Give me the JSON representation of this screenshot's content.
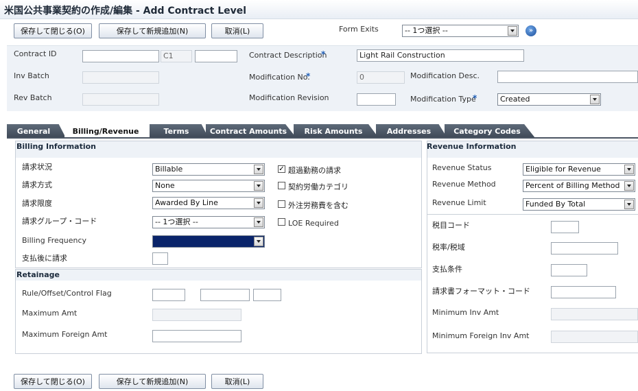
{
  "window": {
    "title": "米国公共事業契約の作成/編集 - Add Contract Level"
  },
  "toolbar": {
    "save_close": "保存して閉じる(O)",
    "save_new": "保存して新規追加(N)",
    "cancel": "取消(L)",
    "form_exits_label": "Form Exits",
    "form_exits_value": "-- 1つ選択 --"
  },
  "header": {
    "contract_id_label": "Contract ID",
    "contract_id_value": "",
    "contract_type": "C1",
    "contract_company": "",
    "contract_desc_label": "Contract Description",
    "contract_desc_value": "Light Rail Construction",
    "inv_batch_label": "Inv Batch",
    "rev_batch_label": "Rev Batch",
    "mod_no_label": "Modification No.",
    "mod_no_value": "0",
    "mod_desc_label": "Modification Desc.",
    "mod_desc_value": "",
    "mod_rev_label": "Modification Revision",
    "mod_rev_value": "",
    "mod_type_label": "Modification Type",
    "mod_type_value": "Created",
    "required_mark": "*"
  },
  "tabs": [
    {
      "label": "General"
    },
    {
      "label": "Billing/Revenue"
    },
    {
      "label": "Terms"
    },
    {
      "label": "Contract Amounts"
    },
    {
      "label": "Risk Amounts"
    },
    {
      "label": "Addresses"
    },
    {
      "label": "Category Codes"
    }
  ],
  "billing": {
    "heading": "Billing Information",
    "status_label": "請求状況",
    "status_value": "Billable",
    "method_label": "請求方式",
    "method_value": "None",
    "limit_label": "請求限度",
    "limit_value": "Awarded By Line",
    "group_label": "請求グループ・コード",
    "group_value": "-- 1つ選択 --",
    "freq_label": "Billing Frequency",
    "freq_value": "",
    "after_pay_label": "支払後に請求",
    "after_pay_value": "",
    "chk_overtime": "超過勤務の請求",
    "chk_labor_cat": "契約労働カテゴリ",
    "chk_outsource": "外注労務費を含む",
    "chk_loe": "LOE Required"
  },
  "retainage": {
    "heading": "Retainage",
    "rule_label": "Rule/Offset/Control Flag",
    "max_amt_label": "Maximum Amt",
    "max_foreign_label": "Maximum Foreign Amt"
  },
  "revenue": {
    "heading": "Revenue Information",
    "status_label": "Revenue Status",
    "status_value": "Eligible for Revenue",
    "method_label": "Revenue Method",
    "method_value": "Percent of Billing Method",
    "limit_label": "Revenue Limit",
    "limit_value": "Funded By Total",
    "tax_code_label": "税目コード",
    "tax_rate_label": "税率/税域",
    "pay_terms_label": "支払条件",
    "inv_format_label": "請求書フォーマット・コード",
    "min_inv_label": "Minimum Inv Amt",
    "min_foreign_inv_label": "Minimum Foreign Inv Amt"
  }
}
